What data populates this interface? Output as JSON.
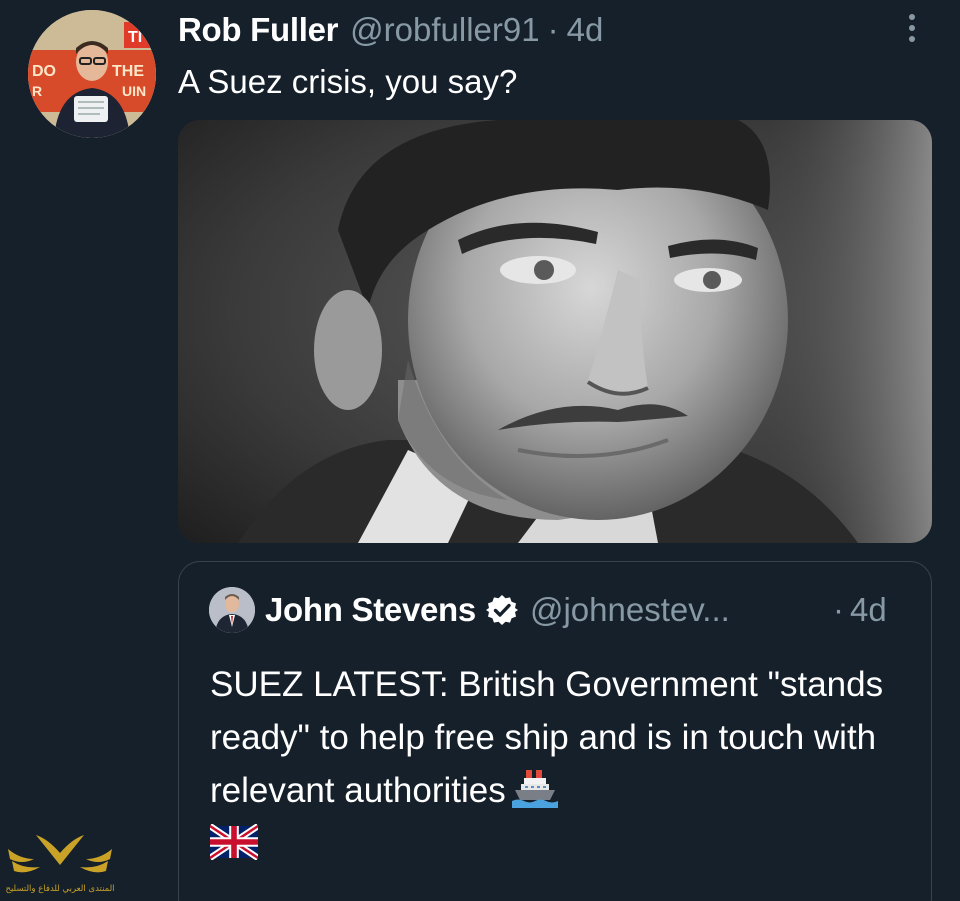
{
  "tweet": {
    "author_name": "Rob Fuller",
    "author_handle": "@robfuller91",
    "separator": "·",
    "time": "4d",
    "text": "A Suez crisis, you say?",
    "avatar_sign_text": [
      "TI",
      "DO",
      "THE",
      "R",
      "UIN"
    ]
  },
  "quoted_tweet": {
    "author_name": "John Stevens",
    "author_handle": "@johnestev...",
    "separator": "·",
    "time": "4d",
    "text": "SUEZ LATEST: British Government \"stands ready\" to help free ship and is in touch with relevant authorities",
    "emoji": [
      "ship-icon",
      "uk-flag-icon"
    ]
  },
  "colors": {
    "background": "#15202b",
    "secondary_text": "#8899a6",
    "border": "#38444d",
    "primary_text": "#ffffff"
  },
  "watermark": {
    "text": "المنتدى العربي للدفاع والتسليح",
    "color": "#c9a227"
  }
}
